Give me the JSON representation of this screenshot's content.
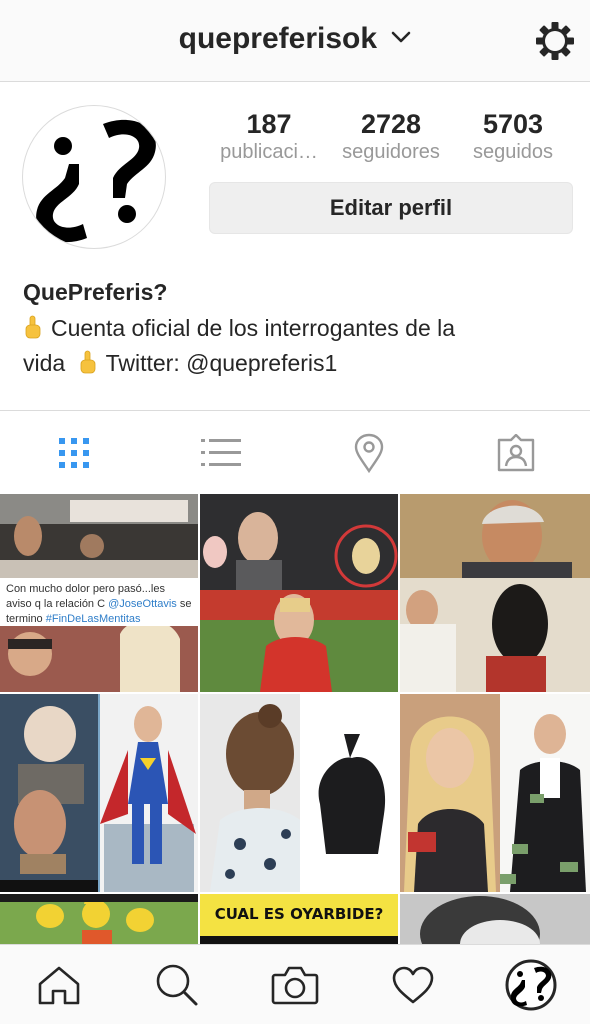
{
  "header": {
    "username": "quepreferisok",
    "settings_icon": "gear-icon",
    "dropdown_icon": "chevron-down-icon"
  },
  "profile": {
    "stats": [
      {
        "value": "187",
        "label": "publicaci…"
      },
      {
        "value": "2728",
        "label": "seguidores"
      },
      {
        "value": "5703",
        "label": "seguidos"
      }
    ],
    "edit_button": "Editar perfil",
    "display_name": "QuePreferis?",
    "bio_line1": "Cuenta oficial de los interrogantes de la",
    "bio_line2_a": "vida",
    "bio_line2_b": "Twitter: @quepreferis1"
  },
  "tabs": [
    {
      "name": "grid-view",
      "icon": "grid-icon",
      "active": true
    },
    {
      "name": "list-view",
      "icon": "list-icon",
      "active": false
    },
    {
      "name": "location",
      "icon": "location-pin-icon",
      "active": false
    },
    {
      "name": "tagged",
      "icon": "tagged-photo-icon",
      "active": false
    }
  ],
  "posts": {
    "post1_caption_a": "Con mucho dolor pero pasó...les aviso q la relación C",
    "post1_caption_link": "@JoseOttavis",
    "post1_caption_b": "se termino",
    "post1_caption_tag": "#FinDeLasMentitas",
    "post8_banner": "CUAL ES OYARBIDE?"
  },
  "bottom_nav": [
    {
      "name": "home",
      "icon": "home-icon"
    },
    {
      "name": "search",
      "icon": "search-icon"
    },
    {
      "name": "camera",
      "icon": "camera-icon"
    },
    {
      "name": "activity",
      "icon": "heart-icon"
    },
    {
      "name": "profile",
      "icon": "profile-avatar-icon"
    }
  ],
  "colors": {
    "active_tab": "#3897f0",
    "inactive_icon": "#999999",
    "text": "#262626"
  }
}
